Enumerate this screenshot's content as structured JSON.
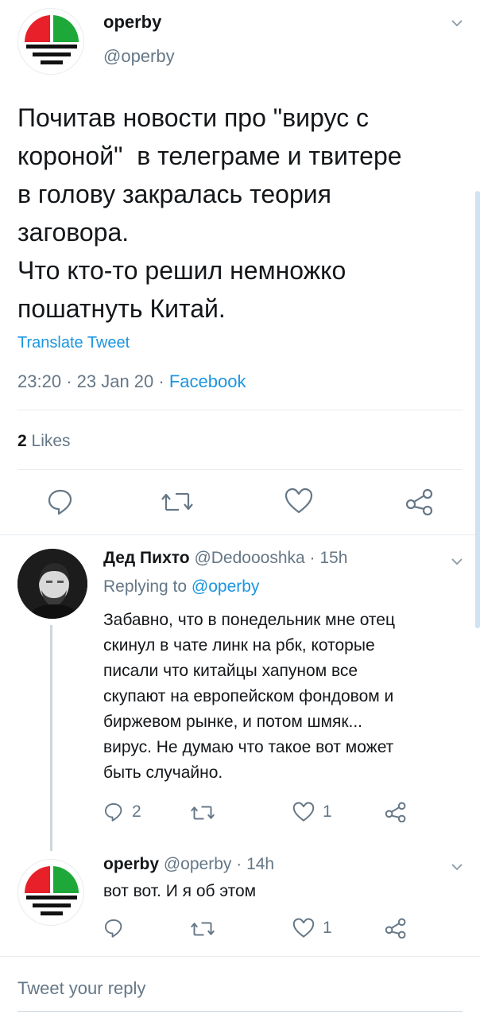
{
  "main_tweet": {
    "display_name": "operby",
    "handle": "@operby",
    "text_lines": [
      "Почитав новости про \"вирус с",
      "короной\"  в телеграме и твитере",
      "в голову закралась теория",
      "заговора.",
      "Что кто-то решил немножко",
      "пошатнуть Китай."
    ],
    "translate_label": "Translate Tweet",
    "time": "23:20",
    "date": "23 Jan 20",
    "separator": "·",
    "source": "Facebook",
    "likes_count": "2",
    "likes_label": "Likes"
  },
  "reply_1": {
    "display_name": "Дед Пихто",
    "handle": "@Dedoooshka",
    "separator": "·",
    "time_ago": "15h",
    "replying_prefix": "Replying to",
    "replying_handle": "@operby",
    "text_lines": [
      "Забавно, что в понедельник мне отец",
      "скинул в чате линк на рбк, которые",
      "писали что китайцы хапуном все",
      "скупают на европейском фондовом и",
      "биржевом рынке, и потом шмяк...",
      "вирус. Не думаю что такое вот может",
      "быть случайно."
    ],
    "reply_count": "2",
    "like_count": "1"
  },
  "reply_2": {
    "display_name": "operby",
    "handle": "@operby",
    "separator": "·",
    "time_ago": "14h",
    "text": "вот вот. И я об этом",
    "like_count": "1"
  },
  "composer": {
    "placeholder": "Tweet your reply"
  },
  "colors": {
    "link_blue": "#1b95e0",
    "secondary_grey": "#657786",
    "logo_red": "#e8202a",
    "logo_green": "#1fa83a"
  },
  "icons": [
    "reply-icon",
    "retweet-icon",
    "like-icon",
    "share-icon",
    "chevron-down-icon"
  ]
}
